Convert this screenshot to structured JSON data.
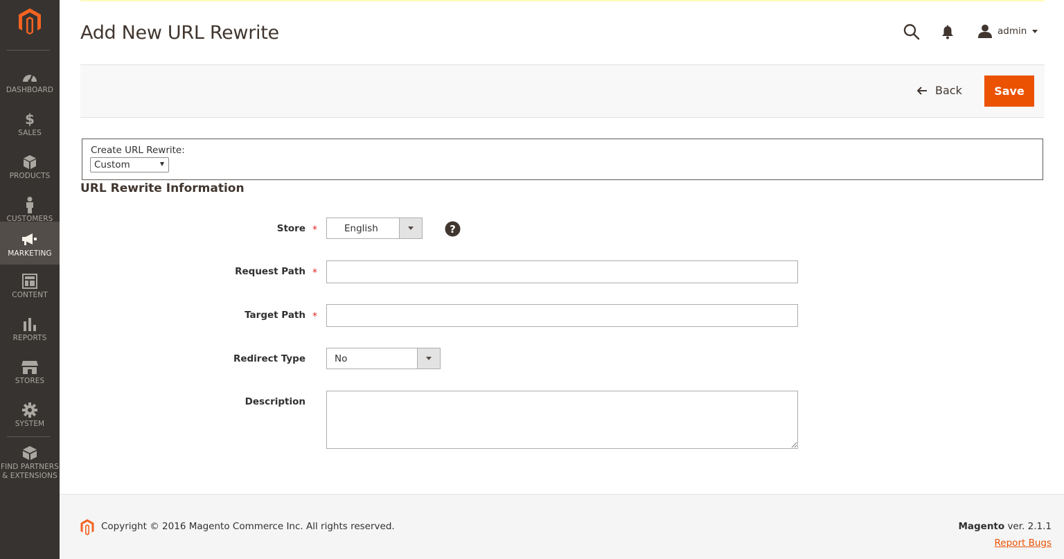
{
  "sidebar": {
    "logo_icon": "magento-logo-icon",
    "items": [
      {
        "label": "DASHBOARD",
        "icon": "dashboard-icon"
      },
      {
        "label": "SALES",
        "icon": "dollar-icon"
      },
      {
        "label": "PRODUCTS",
        "icon": "box-icon"
      },
      {
        "label": "CUSTOMERS",
        "icon": "person-icon"
      },
      {
        "label": "MARKETING",
        "icon": "megaphone-icon",
        "active": true
      },
      {
        "label": "CONTENT",
        "icon": "layout-icon"
      },
      {
        "label": "REPORTS",
        "icon": "bar-chart-icon"
      },
      {
        "label": "STORES",
        "icon": "storefront-icon"
      },
      {
        "label": "SYSTEM",
        "icon": "gear-icon"
      },
      {
        "label_line1": "FIND PARTNERS",
        "label_line2": "& EXTENSIONS",
        "icon": "partners-box-icon"
      }
    ]
  },
  "header": {
    "title": "Add New URL Rewrite",
    "user": "admin"
  },
  "actions": {
    "back_label": "Back",
    "save_label": "Save"
  },
  "create_rewrite": {
    "label": "Create URL Rewrite:",
    "selected": "Custom"
  },
  "section": {
    "title": "URL Rewrite Information"
  },
  "form": {
    "store": {
      "label": "Store",
      "value": "English"
    },
    "request_path": {
      "label": "Request Path",
      "value": ""
    },
    "target_path": {
      "label": "Target Path",
      "value": ""
    },
    "redirect_type": {
      "label": "Redirect Type",
      "value": "No"
    },
    "description": {
      "label": "Description",
      "value": ""
    },
    "required_mark": "*"
  },
  "footer": {
    "copyright": "Copyright © 2016 Magento Commerce Inc. All rights reserved.",
    "brand": "Magento",
    "version": " ver. 2.1.1",
    "report_bugs": "Report Bugs"
  },
  "colors": {
    "sidebar_bg": "#373330",
    "sidebar_active": "#524d49",
    "accent": "#eb5202",
    "required": "#e22626"
  }
}
